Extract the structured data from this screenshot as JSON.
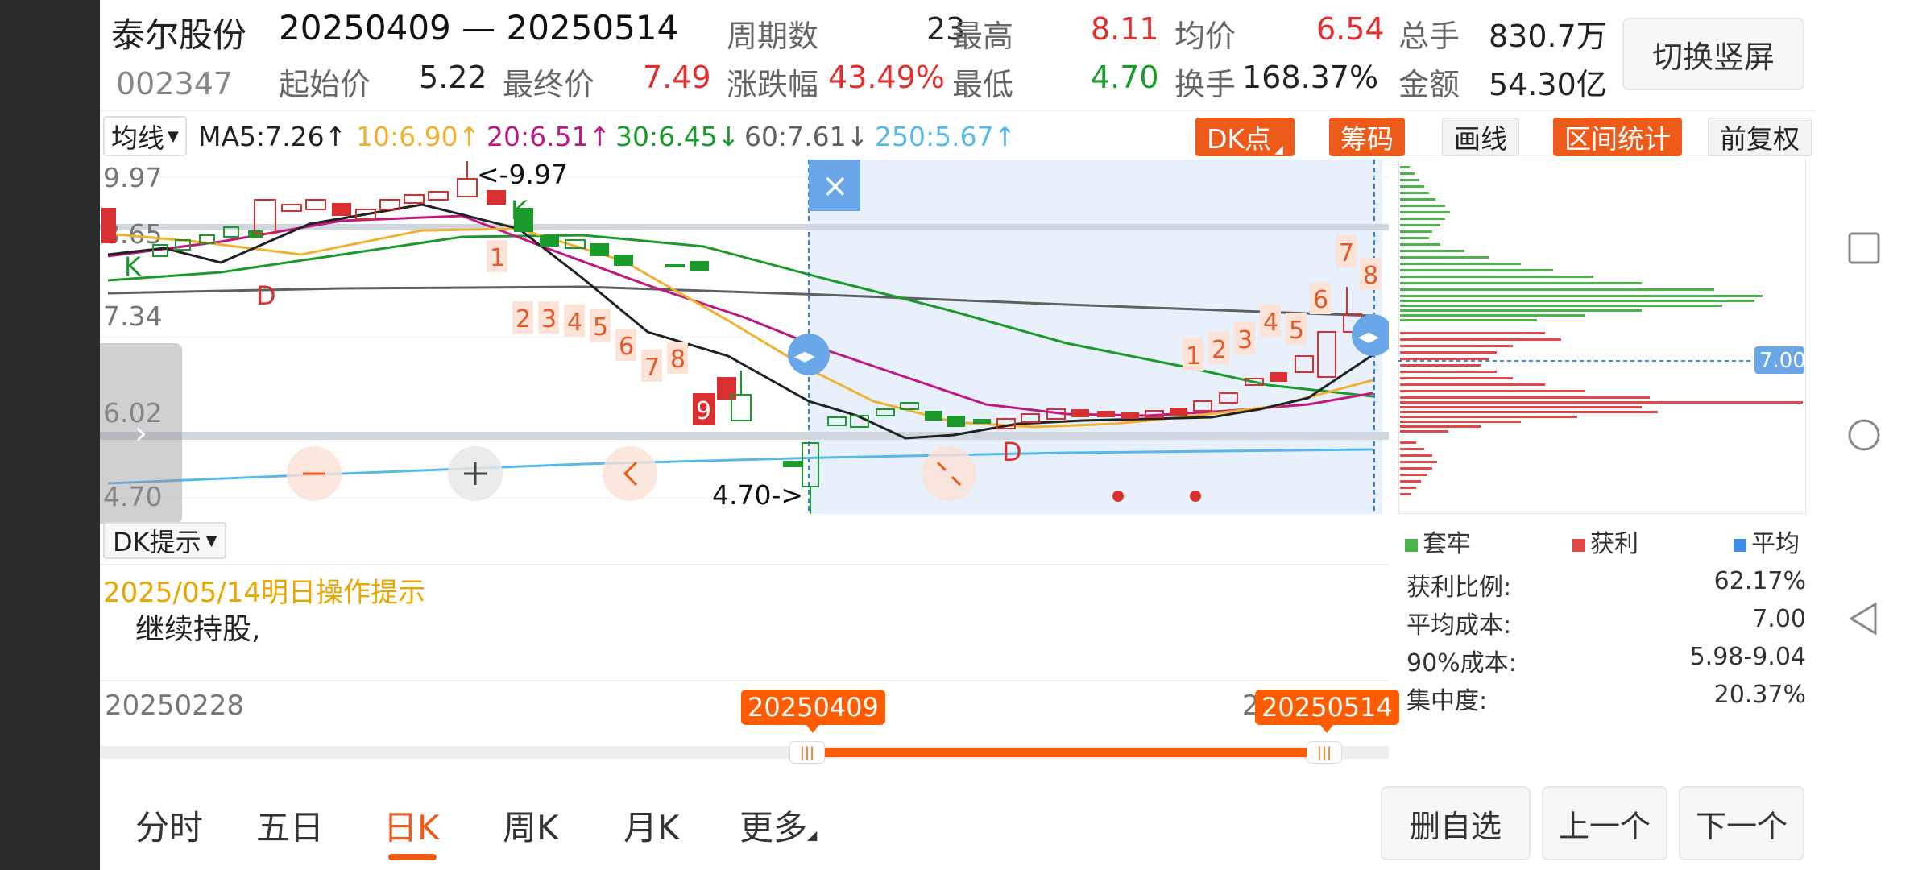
{
  "header": {
    "stock_name": "泰尔股份",
    "stock_code": "002347",
    "date_range": "20250409 — 20250514",
    "period_label": "周期数",
    "period_value": "23",
    "high_label": "最高",
    "high_value": "8.11",
    "avg_label": "均价",
    "avg_value": "6.54",
    "total_vol_label": "总手",
    "total_vol_value": "830.7万",
    "start_label": "起始价",
    "start_value": "5.22",
    "end_label": "最终价",
    "end_value": "7.49",
    "change_label": "涨跌幅",
    "change_value": "43.49%",
    "low_label": "最低",
    "low_value": "4.70",
    "turnover_label": "换手",
    "turnover_value": "168.37%",
    "amount_label": "金额",
    "amount_value": "54.30亿",
    "switch_button": "切换竖屏"
  },
  "ma_row": {
    "select_label": "均线",
    "ma5": "MA5:7.26↑",
    "ma10": "10:6.90↑",
    "ma20": "20:6.51↑",
    "ma30": "30:6.45↓",
    "ma60": "60:7.61↓",
    "ma250": "250:5.67↑",
    "btn_dk": "DK点",
    "btn_chips": "筹码",
    "btn_draw": "画线",
    "btn_interval": "区间统计",
    "btn_adjust": "前复权"
  },
  "colors": {
    "accent": "#ee5a1a",
    "up": "#e03030",
    "down": "#1a9a2a",
    "ma5": "#222222",
    "ma10": "#f0b030",
    "ma20": "#c01880",
    "ma30": "#1a9a2a",
    "ma60": "#606060",
    "ma250": "#58b8e8",
    "range_fill": "#e8f1fb",
    "chip_blue": "#3a8ee6"
  },
  "chart": {
    "y_labels": [
      "9.97",
      "8.65",
      "7.34",
      "6.02",
      "4.70"
    ],
    "high_mark": "<-9.97",
    "low_mark": "4.70->",
    "marker_d": "D",
    "marker_k": "K",
    "seq_down": [
      "1",
      "2",
      "3",
      "4",
      "5",
      "6",
      "7",
      "8",
      "9"
    ],
    "seq_up": [
      "1",
      "2",
      "3",
      "4",
      "5",
      "6",
      "7",
      "8"
    ],
    "close_icon": "×"
  },
  "chips": {
    "price_tag": "7.00",
    "legend_trapped": "套牢",
    "legend_profit": "获利",
    "legend_avg": "平均",
    "stats": [
      {
        "label": "获利比例:",
        "value": "62.17%"
      },
      {
        "label": "平均成本:",
        "value": "7.00"
      },
      {
        "label": "90%成本:",
        "value": "5.98-9.04"
      },
      {
        "label": "集中度:",
        "value": "20.37%"
      }
    ]
  },
  "tips": {
    "select_label": "DK提示",
    "title": "2025/05/14明日操作提示",
    "text": "继续持股,"
  },
  "timeline": {
    "start_date": "20250228",
    "range_start": "20250409",
    "range_end": "20250514",
    "hidden_end_prefix": "2"
  },
  "bottom_tabs": [
    {
      "label": "分时"
    },
    {
      "label": "五日"
    },
    {
      "label": "日K"
    },
    {
      "label": "周K"
    },
    {
      "label": "月K"
    },
    {
      "label": "更多"
    }
  ],
  "bottom_buttons": {
    "remove_watch": "删自选",
    "prev": "上一个",
    "next": "下一个"
  }
}
